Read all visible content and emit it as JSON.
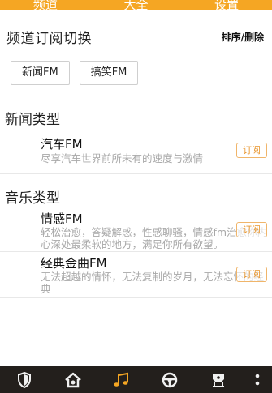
{
  "top_tabs": [
    "频道",
    "大全",
    "设置"
  ],
  "subscription": {
    "title": "频道订阅切换",
    "action": "排序/删除",
    "chips": [
      "新闻FM",
      "搞笑FM"
    ]
  },
  "sections": [
    {
      "title": "新闻类型",
      "items": [
        {
          "name": "汽车FM",
          "desc": "尽享汽车世界前所未有的速度与激情",
          "button": "订阅"
        }
      ]
    },
    {
      "title": "音乐类型",
      "items": [
        {
          "name": "情感FM",
          "desc": "轻松治愈，答疑解惑，性感聊骚，情感fm治愈你内心深处最柔软的地方，满足你所有欲望。",
          "button": "订阅"
        },
        {
          "name": "经典金曲FM",
          "desc": "无法超越的情怀，无法复制的岁月，无法忘怀的经典",
          "button": "订阅"
        }
      ]
    }
  ],
  "bottom_nav": {
    "icons": [
      "shield-icon",
      "home-icon",
      "music-icon",
      "steering-wheel-icon",
      "car-seat-icon",
      "more-icon"
    ],
    "active_color": "#f5a623",
    "icon_color": "#f0f0f0"
  },
  "colors": {
    "accent": "#f5a623",
    "nav_bg": "#231f1c"
  }
}
